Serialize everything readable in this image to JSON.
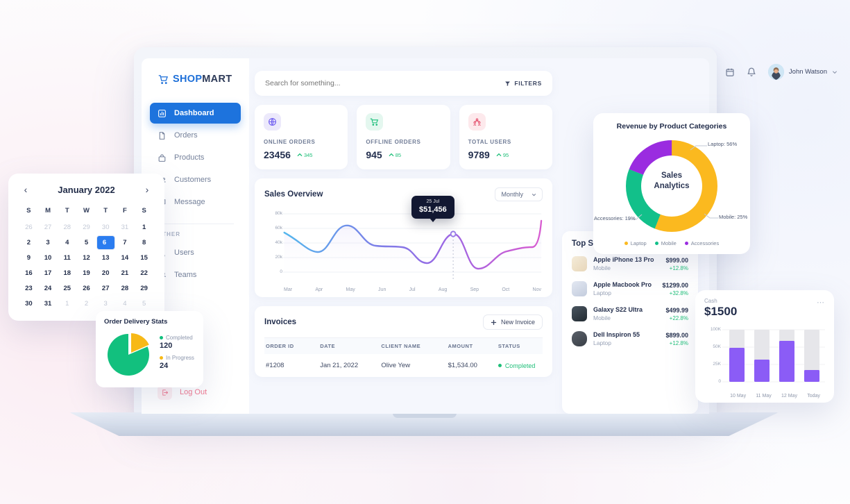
{
  "brand": {
    "name_bold": "SHOP",
    "name_light": "MART",
    "icon": "cart-icon"
  },
  "sidebar": {
    "items": [
      {
        "label": "Dashboard",
        "icon": "bar-chart-icon",
        "active": true
      },
      {
        "label": "Orders",
        "icon": "document-icon",
        "active": false
      },
      {
        "label": "Products",
        "icon": "bag-icon",
        "active": false
      },
      {
        "label": "Customers",
        "icon": "people-icon",
        "active": false
      },
      {
        "label": "Message",
        "icon": "message-icon",
        "active": false
      }
    ],
    "section_header": "OTHER",
    "other_items": [
      {
        "label": "Users",
        "icon": "user-icon"
      },
      {
        "label": "Teams",
        "icon": "team-icon"
      }
    ],
    "logout": {
      "label": "Log Out",
      "icon": "logout-icon"
    }
  },
  "search": {
    "placeholder": "Search for something...",
    "value": "",
    "filters_label": "FILTERS",
    "filters_icon": "funnel-icon"
  },
  "topbar": {
    "calendar_icon": "calendar-icon",
    "bell_icon": "bell-icon",
    "user_name": "John Watson",
    "chevron_icon": "chevron-down-icon"
  },
  "stats": [
    {
      "label": "ONLINE ORDERS",
      "value": "23456",
      "delta": "345",
      "delta_icon": "caret-up-icon",
      "icon": "globe-icon",
      "icon_bg": "#ece9fb",
      "icon_color": "#6d5bf0"
    },
    {
      "label": "OFFLINE ORDERS",
      "value": "945",
      "delta": "85",
      "delta_icon": "caret-up-icon",
      "icon": "cart-icon",
      "icon_bg": "#e4f7ef",
      "icon_color": "#17bd78"
    },
    {
      "label": "TOTAL USERS",
      "value": "9789",
      "delta": "95",
      "delta_icon": "caret-up-icon",
      "icon": "users-icon",
      "icon_bg": "#fde9ec",
      "icon_color": "#e4506d"
    }
  ],
  "sales_overview": {
    "title": "Sales Overview",
    "period_selected": "Monthly",
    "tooltip_date": "25 Jul",
    "tooltip_value": "$51,456"
  },
  "invoices": {
    "title": "Invoices",
    "new_label": "New Invoice",
    "new_icon": "plus-icon",
    "columns": [
      "ORDER ID",
      "DATE",
      "CLIENT NAME",
      "AMOUNT",
      "STATUS"
    ],
    "rows": [
      {
        "order_id": "#1208",
        "date": "Jan 21, 2022",
        "client": "Olive Yew",
        "amount": "$1,534.00",
        "status": "Completed",
        "status_color": "#1fbf79"
      }
    ]
  },
  "top_products": {
    "title": "Top Sale Products",
    "items": [
      {
        "name": "Apple iPhone 13 Pro",
        "category": "Mobile",
        "price": "$999.00",
        "change": "+12.8%",
        "thumb_color": "#f4e9d8"
      },
      {
        "name": "Apple Macbook Pro",
        "category": "Laptop",
        "price": "$1299.00",
        "change": "+32.8%",
        "thumb_color": "#dfe4ef"
      },
      {
        "name": "Galaxy S22 Ultra",
        "category": "Mobile",
        "price": "$499.99",
        "change": "+22.8%",
        "thumb_color": "#2f3a42"
      },
      {
        "name": "Dell Inspiron 55",
        "category": "Laptop",
        "price": "$899.00",
        "change": "+12.8%",
        "thumb_color": "#454b52"
      }
    ]
  },
  "order_delivery": {
    "title": "Order Delivery Stats",
    "legend": [
      {
        "label": "Completed",
        "value": "120",
        "color": "#12c07e"
      },
      {
        "label": "In Progress",
        "value": "24",
        "color": "#f7b917"
      }
    ]
  },
  "calendar": {
    "month_label": "January 2022",
    "prev_icon": "chevron-left-icon",
    "next_icon": "chevron-right-icon",
    "dow": [
      "S",
      "M",
      "T",
      "W",
      "T",
      "F",
      "S"
    ],
    "selected_day": 6,
    "weeks": [
      [
        {
          "d": "26",
          "mut": true
        },
        {
          "d": "27",
          "mut": true
        },
        {
          "d": "28",
          "mut": true
        },
        {
          "d": "29",
          "mut": true
        },
        {
          "d": "30",
          "mut": true
        },
        {
          "d": "31",
          "mut": true
        },
        {
          "d": "1",
          "mut": false
        }
      ],
      [
        {
          "d": "2",
          "mut": false
        },
        {
          "d": "3",
          "mut": false
        },
        {
          "d": "4",
          "mut": false
        },
        {
          "d": "5",
          "mut": false
        },
        {
          "d": "6",
          "mut": false,
          "sel": true
        },
        {
          "d": "7",
          "mut": false
        },
        {
          "d": "8",
          "mut": false
        }
      ],
      [
        {
          "d": "9",
          "mut": false
        },
        {
          "d": "10",
          "mut": false
        },
        {
          "d": "11",
          "mut": false
        },
        {
          "d": "12",
          "mut": false
        },
        {
          "d": "13",
          "mut": false
        },
        {
          "d": "14",
          "mut": false
        },
        {
          "d": "15",
          "mut": false
        }
      ],
      [
        {
          "d": "16",
          "mut": false
        },
        {
          "d": "17",
          "mut": false
        },
        {
          "d": "18",
          "mut": false
        },
        {
          "d": "19",
          "mut": false
        },
        {
          "d": "20",
          "mut": false
        },
        {
          "d": "21",
          "mut": false
        },
        {
          "d": "22",
          "mut": false
        }
      ],
      [
        {
          "d": "23",
          "mut": false
        },
        {
          "d": "24",
          "mut": false
        },
        {
          "d": "25",
          "mut": false
        },
        {
          "d": "26",
          "mut": false
        },
        {
          "d": "27",
          "mut": false
        },
        {
          "d": "28",
          "mut": false
        },
        {
          "d": "29",
          "mut": false
        }
      ],
      [
        {
          "d": "30",
          "mut": false
        },
        {
          "d": "31",
          "mut": false
        },
        {
          "d": "1",
          "mut": true
        },
        {
          "d": "2",
          "mut": true
        },
        {
          "d": "3",
          "mut": true
        },
        {
          "d": "4",
          "mut": true
        },
        {
          "d": "5",
          "mut": true
        }
      ]
    ]
  },
  "revenue_card": {
    "title": "Revenue by Product Categories",
    "center_line1": "Sales",
    "center_line2": "Analytics",
    "callouts": [
      {
        "text": "Laptop: 56%"
      },
      {
        "text": "Mobile: 25%"
      },
      {
        "text": "Accessories: 19%"
      }
    ],
    "legend": [
      {
        "label": "Laptop",
        "color": "#fbb91f"
      },
      {
        "label": "Mobile",
        "color": "#12c08a"
      },
      {
        "label": "Accessories",
        "color": "#9a2ce0"
      }
    ]
  },
  "cash_card": {
    "label": "Cash",
    "value": "$1500",
    "menu_icon": "more-horizontal-icon"
  },
  "chart_data": [
    {
      "type": "line",
      "title": "Sales Overview",
      "xlabel": "",
      "ylabel": "",
      "x": [
        "Mar",
        "Apr",
        "May",
        "Jun",
        "Jul",
        "Aug",
        "Sep",
        "Oct",
        "Nov"
      ],
      "values": [
        54000,
        31000,
        57000,
        36000,
        22000,
        51456,
        13000,
        35000,
        68000
      ],
      "ytick_labels": [
        "0",
        "20k",
        "40k",
        "60k",
        "80k"
      ],
      "yticks": [
        0,
        20000,
        40000,
        60000,
        80000
      ],
      "ylim": [
        0,
        80000
      ],
      "grid": true,
      "legend": "none",
      "annotation": {
        "x": "25 Jul",
        "y": 51456,
        "label": "$51,456"
      }
    },
    {
      "type": "pie",
      "title": "Order Delivery Stats",
      "labels": [
        "Completed",
        "In Progress"
      ],
      "values": [
        120,
        24
      ],
      "colors": [
        "#12c07e",
        "#f7b917"
      ],
      "legend": "right"
    },
    {
      "type": "pie",
      "title": "Revenue by Product Categories",
      "subtitle": "Sales Analytics",
      "labels": [
        "Laptop",
        "Mobile",
        "Accessories"
      ],
      "values": [
        56,
        25,
        19
      ],
      "colors": [
        "#fbb91f",
        "#12c08a",
        "#9a2ce0"
      ],
      "legend": "bottom",
      "donut": true
    },
    {
      "type": "bar",
      "title": "Cash",
      "categories": [
        "10 May",
        "11 May",
        "12 May",
        "Today"
      ],
      "values": [
        65000,
        42000,
        78000,
        22000
      ],
      "track_max": 100000,
      "ytick_labels": [
        "0",
        "25K",
        "50K",
        "100K"
      ],
      "yticks": [
        0,
        25000,
        50000,
        100000
      ],
      "ylim": [
        0,
        100000
      ],
      "bar_color": "#8b5cf6",
      "track_color": "#e6e6ea",
      "grid": true,
      "legend": "none"
    }
  ]
}
